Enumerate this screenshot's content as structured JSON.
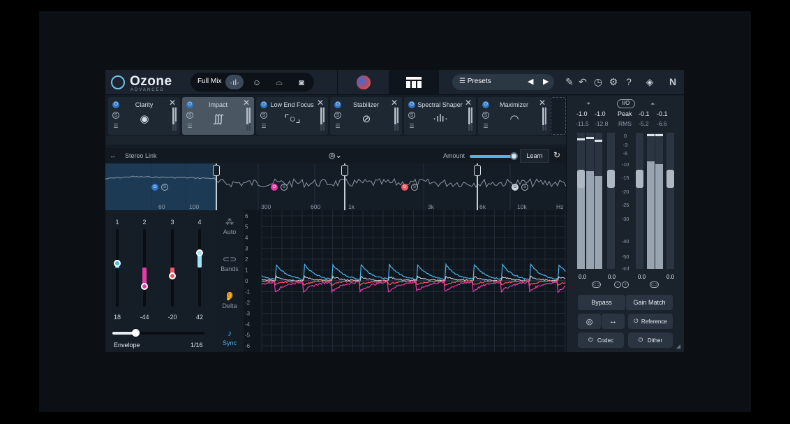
{
  "brand": {
    "name": "Ozone",
    "edition": "ADVANCED"
  },
  "topbar": {
    "mix_label": "Full Mix",
    "presets_label": "Presets"
  },
  "modules": [
    {
      "name": "Clarity",
      "icon": "eye-icon"
    },
    {
      "name": "Impact",
      "icon": "impact-icon"
    },
    {
      "name": "Low End Focus",
      "icon": "focus-icon"
    },
    {
      "name": "Stabilizer",
      "icon": "stabilizer-icon"
    },
    {
      "name": "Spectral Shaper",
      "icon": "spectral-icon"
    },
    {
      "name": "Maximizer",
      "icon": "gauge-icon"
    }
  ],
  "stereo": {
    "label": "Stereo Link",
    "amount_label": "Amount",
    "learn_label": "Learn"
  },
  "spectrum": {
    "freq_labels": [
      "60",
      "100",
      "300",
      "600",
      "1k",
      "3k",
      "6k",
      "10k",
      "Hz"
    ]
  },
  "faders": [
    {
      "num": "1",
      "value": "18",
      "color": "#4bb4ea"
    },
    {
      "num": "2",
      "value": "-44",
      "color": "#e83aa6"
    },
    {
      "num": "3",
      "value": "-20",
      "color": "#f05a63"
    },
    {
      "num": "4",
      "value": "42",
      "color": "#9fe3f7"
    }
  ],
  "envelope": {
    "label": "Envelope",
    "value": "1/16"
  },
  "modes": [
    {
      "label": "Auto",
      "glyph": "⁂"
    },
    {
      "label": "Bands",
      "glyph": "⊂⊃"
    },
    {
      "label": "Delta",
      "glyph": "👂"
    },
    {
      "label": "Sync",
      "glyph": "♪"
    }
  ],
  "graph": {
    "y_labels": [
      "6",
      "5",
      "4",
      "3",
      "2",
      "1",
      "0",
      "-1",
      "-2",
      "-3",
      "-4",
      "-5",
      "-6"
    ]
  },
  "meters": {
    "in_peak": [
      "-1.0",
      "-1.0"
    ],
    "in_rms": [
      "-11.5",
      "-12.8"
    ],
    "out_peak": [
      "-0.1",
      "-0.1"
    ],
    "out_rms": [
      "-5.2",
      "-6.6"
    ],
    "peak_label": "Peak",
    "rms_label": "RMS",
    "io_label": "I/O",
    "scale": [
      "0",
      "-3",
      "-6",
      "-10",
      "-15",
      "-20",
      "-25",
      "-30",
      "-40",
      "-50",
      "-Inf"
    ],
    "bottom": [
      "0.0",
      "0.0",
      "0.0",
      "0.0"
    ]
  },
  "buttons": {
    "bypass": "Bypass",
    "gain_match": "Gain Match",
    "reference": "Reference",
    "codec": "Codec",
    "dither": "Dither"
  }
}
